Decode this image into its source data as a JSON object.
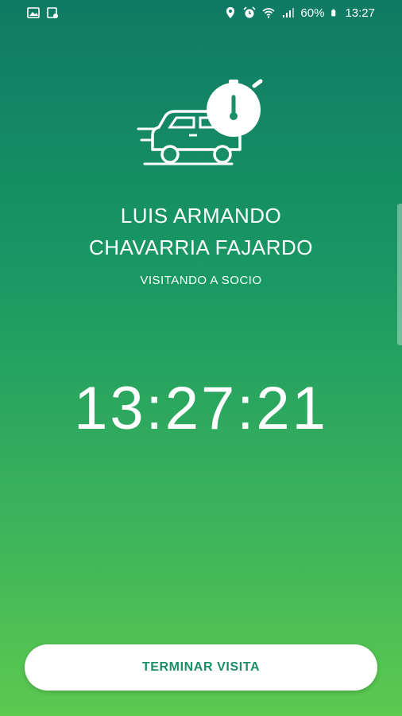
{
  "status_bar": {
    "battery_percent": "60%",
    "time": "13:27",
    "icons": [
      "gallery-icon",
      "screenshot-icon",
      "location-icon",
      "alarm-icon",
      "wifi-icon",
      "signal-icon",
      "battery-icon"
    ]
  },
  "visitor": {
    "name_line1": "LUIS ARMANDO",
    "name_line2": "CHAVARRIA FAJARDO",
    "status": "VISITANDO A SOCIO"
  },
  "timer": {
    "value": "13:27:21"
  },
  "actions": {
    "end_visit_label": "TERMINAR VISITA"
  },
  "colors": {
    "gradient_top": "#0f7a64",
    "gradient_bottom": "#5cc94f",
    "button_text": "#1b8f6a",
    "icon_badge": "#ffffff"
  },
  "hero_icon": "car-with-stopwatch-icon"
}
